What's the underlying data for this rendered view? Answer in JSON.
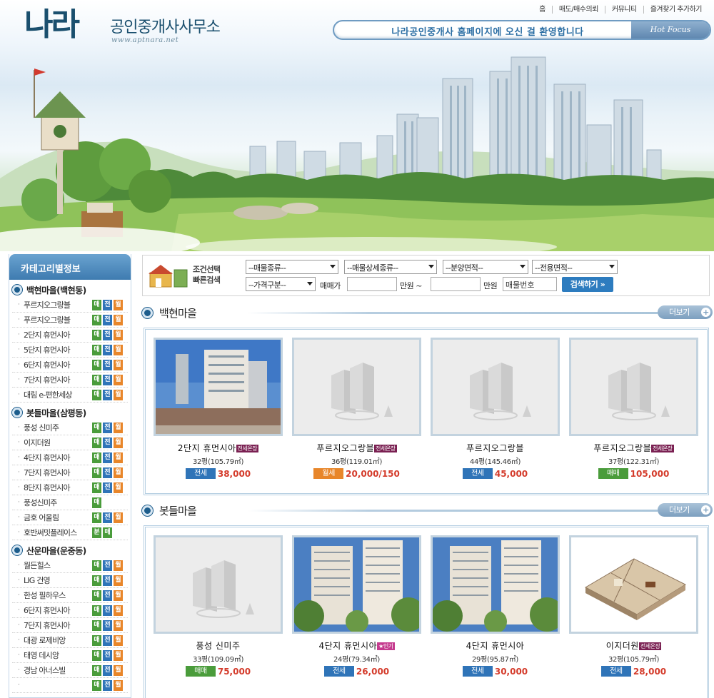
{
  "header": {
    "logo_mark": "나라",
    "logo_text": "공인중개사사무소",
    "logo_url": "www.aptnara.net",
    "nav": [
      "홈",
      "매도/매수의뢰",
      "커뮤니티",
      "즐겨찾기 추가하기"
    ],
    "welcome": "나라공인중개사 홈페이지에 오신 걸 환영합니다",
    "hot_focus": "Hot Focus"
  },
  "sidebar": {
    "title": "카테고리별정보",
    "groups": [
      {
        "title": "백현마을(백현동)",
        "items": [
          {
            "name": "푸르지오그랑블",
            "badges": [
              "매",
              "전",
              "월"
            ]
          },
          {
            "name": "푸르지오그랑블",
            "badges": [
              "매",
              "전",
              "월"
            ]
          },
          {
            "name": "2단지 휴먼시아",
            "badges": [
              "매",
              "전",
              "월"
            ]
          },
          {
            "name": "5단지 휴먼시아",
            "badges": [
              "매",
              "전",
              "월"
            ]
          },
          {
            "name": "6단지 휴먼시아",
            "badges": [
              "매",
              "전",
              "월"
            ]
          },
          {
            "name": "7단지 휴먼시아",
            "badges": [
              "매",
              "전",
              "월"
            ]
          },
          {
            "name": "대림 e-편한세상",
            "badges": [
              "매",
              "전",
              "월"
            ]
          }
        ]
      },
      {
        "title": "봇들마을(삼평동)",
        "items": [
          {
            "name": "풍성 신미주",
            "badges": [
              "매",
              "전",
              "월"
            ]
          },
          {
            "name": "이지더원",
            "badges": [
              "매",
              "전",
              "월"
            ]
          },
          {
            "name": "4단지 휴먼시아",
            "badges": [
              "매",
              "전",
              "월"
            ]
          },
          {
            "name": "7단지 휴먼시아",
            "badges": [
              "매",
              "전",
              "월"
            ]
          },
          {
            "name": "8단지 휴먼시아",
            "badges": [
              "매",
              "전",
              "월"
            ]
          },
          {
            "name": "풍성신미주",
            "badges": [
              "매"
            ]
          },
          {
            "name": "금호 어울림",
            "badges": [
              "매",
              "전",
              "월"
            ]
          },
          {
            "name": "호반써밋플레이스",
            "badges": [
              "분",
              "매"
            ]
          }
        ]
      },
      {
        "title": "산운마을(운중동)",
        "items": [
          {
            "name": "월든힐스",
            "badges": [
              "매",
              "전",
              "월"
            ]
          },
          {
            "name": "LIG 건영",
            "badges": [
              "매",
              "전",
              "월"
            ]
          },
          {
            "name": "한성 필하우스",
            "badges": [
              "매",
              "전",
              "월"
            ]
          },
          {
            "name": "6단지 휴먼시아",
            "badges": [
              "매",
              "전",
              "월"
            ]
          },
          {
            "name": "7단지 휴먼시아",
            "badges": [
              "매",
              "전",
              "월"
            ]
          },
          {
            "name": "대광 로제비앙",
            "badges": [
              "매",
              "전",
              "월"
            ]
          },
          {
            "name": "태영 데시앙",
            "badges": [
              "매",
              "전",
              "월"
            ]
          },
          {
            "name": "경남 아너스빌",
            "badges": [
              "매",
              "전",
              "월"
            ]
          },
          {
            "name": "",
            "badges": [
              "매",
              "전",
              "월"
            ]
          }
        ]
      }
    ]
  },
  "search": {
    "label_line1": "조건선택",
    "label_line2": "빠른검색",
    "type": "--매물종류--",
    "detail_type": "--매물상세종류--",
    "sale_area": "--분양면적--",
    "exclusive_area": "--전용면적--",
    "price_kind": "--가격구분--",
    "sale_price_label": "매매가",
    "unit1": "만원 ~",
    "unit2": "만원",
    "item_no_placeholder": "매물번호",
    "button": "검색하기 »"
  },
  "sections": [
    {
      "title": "백현마을",
      "more": "더보기",
      "cards": [
        {
          "image": "building-photo",
          "title": "2단지 휴먼시아",
          "tag": "전세온장",
          "size": "32평(105.79㎡)",
          "ptype": "전세",
          "price": "38,000"
        },
        {
          "image": "no-image",
          "title": "푸르지오그랑블",
          "tag": "전세온장",
          "size": "36평(119.01㎡)",
          "ptype": "월세",
          "price": "20,000/150"
        },
        {
          "image": "no-image",
          "title": "푸르지오그랑블",
          "tag": "",
          "size": "44평(145.46㎡)",
          "ptype": "전세",
          "price": "45,000"
        },
        {
          "image": "no-image",
          "title": "푸르지오그랑블",
          "tag": "전세온장",
          "size": "37평(122.31㎡)",
          "ptype": "매매",
          "price": "105,000"
        }
      ]
    },
    {
      "title": "봇들마을",
      "more": "더보기",
      "cards": [
        {
          "image": "no-image",
          "title": "풍성 신미주",
          "tag": "",
          "size": "33평(109.09㎡)",
          "ptype": "매매",
          "price": "75,000"
        },
        {
          "image": "tower-photo",
          "title": "4단지 휴먼시아",
          "tag": "★인기",
          "size": "24평(79.34㎡)",
          "ptype": "전세",
          "price": "26,000"
        },
        {
          "image": "tower-photo",
          "title": "4단지 휴먼시아",
          "tag": "",
          "size": "29평(95.87㎡)",
          "ptype": "전세",
          "price": "30,000"
        },
        {
          "image": "floorplan",
          "title": "이지더원",
          "tag": "전세온장",
          "size": "32평(105.79㎡)",
          "ptype": "전세",
          "price": "28,000"
        }
      ]
    }
  ],
  "colors": {
    "sale": "#4a9c3b",
    "jeonse": "#2f74b8",
    "rent": "#e8862a",
    "price": "#d43b2b",
    "accent": "#2d7cbf"
  }
}
